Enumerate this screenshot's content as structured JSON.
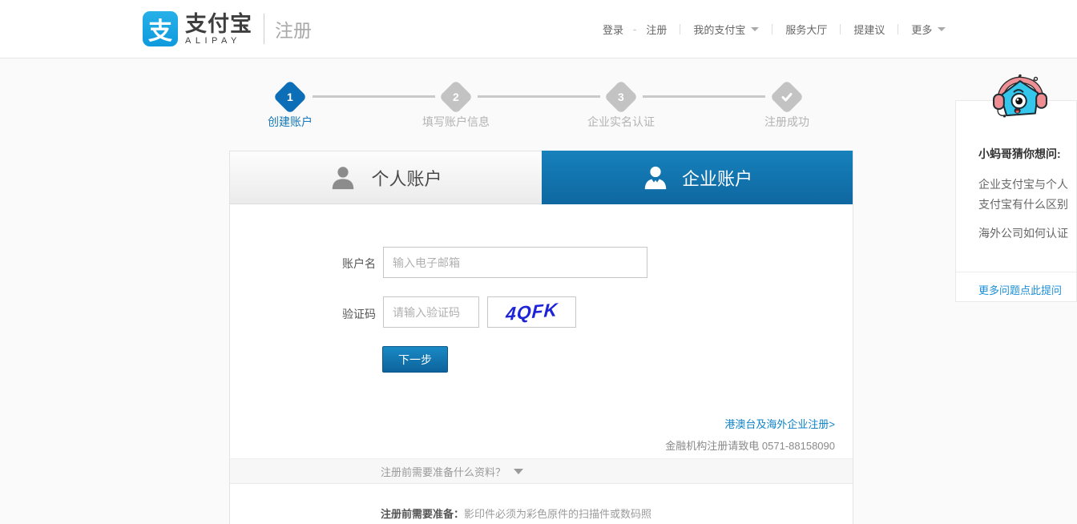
{
  "header": {
    "logo": {
      "icon_char": "支",
      "brand": "支付宝",
      "brand_sub": "ALIPAY",
      "page": "注册"
    },
    "nav": {
      "login": "登录",
      "dash": "-",
      "register": "注册",
      "my_alipay": "我的支付宝",
      "service_hall": "服务大厅",
      "suggest": "提建议",
      "more": "更多"
    }
  },
  "steps": {
    "items": [
      {
        "num": "1",
        "label": "创建账户",
        "state": "active"
      },
      {
        "num": "2",
        "label": "填写账户信息",
        "state": "inactive"
      },
      {
        "num": "3",
        "label": "企业实名认证",
        "state": "inactive"
      },
      {
        "icon": "check-icon",
        "label": "注册成功",
        "state": "inactive"
      }
    ]
  },
  "tabs": {
    "personal": "个人账户",
    "enterprise": "企业账户"
  },
  "form": {
    "account_label": "账户名",
    "account_placeholder": "输入电子邮箱",
    "captcha_label": "验证码",
    "captcha_placeholder": "请输入验证码",
    "captcha_text": "4QFK",
    "next_button": "下一步",
    "overseas_link": "港澳台及海外企业注册>",
    "finance_note": "金融机构注册请致电 0571-88158090"
  },
  "accordion": {
    "question": "注册前需要准备什么资料？"
  },
  "prep": {
    "bold": "注册前需要准备：",
    "text": "影印件必须为彩色原件的扫描件或数码照"
  },
  "sidebar": {
    "title": "小蚂哥猜你想问:",
    "q1_line1": "企业支付宝与个人",
    "q1_line2": "支付宝有什么区别",
    "q2": "海外公司如何认证",
    "more_link": "更多问题点此提问"
  },
  "colors": {
    "accent_blue": "#0d6eb8",
    "tab_blue": "#1377b1",
    "logo_blue": "#1aa2e4",
    "link_blue": "#0e82c8",
    "captcha_blue": "#1d23d6",
    "inactive_gray": "#c3c3c3",
    "page_bg": "#fafafa"
  }
}
